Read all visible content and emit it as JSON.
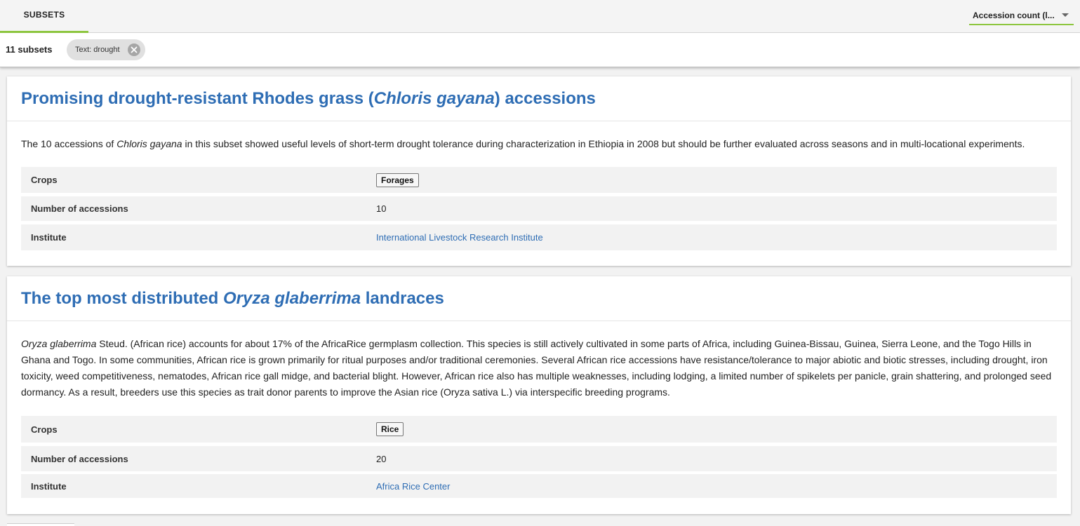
{
  "tabs": {
    "subsets_label": "SUBSETS"
  },
  "sort": {
    "selected": "Accession count (l..."
  },
  "filters": {
    "count_label": "11 subsets",
    "chips": [
      {
        "label": "Text: drought"
      }
    ]
  },
  "subsets": [
    {
      "title_prefix": "Promising drought-resistant Rhodes grass (",
      "title_italic": "Chloris gayana",
      "title_suffix": ") accessions",
      "desc_prefix": "The 10 accessions of ",
      "desc_italic": "Chloris gayana",
      "desc_rest": " in this subset showed useful levels of short-term drought tolerance during characterization in Ethiopia in 2008 but should be further evaluated across seasons and in multi-locational experiments.",
      "crops_label": "Crops",
      "crop": "Forages",
      "accessions_label": "Number of accessions",
      "accessions": "10",
      "institute_label": "Institute",
      "institute": "International Livestock Research Institute"
    },
    {
      "title_prefix": "The top most distributed ",
      "title_italic": "Oryza glaberrima",
      "title_suffix": " landraces",
      "desc_prefix": "",
      "desc_italic": "Oryza glaberrima",
      "desc_rest": " Steud. (African rice) accounts for about 17% of the AfricaRice germplasm collection. This species is still actively cultivated in some parts of Africa, including Guinea-Bissau, Guinea, Sierra Leone, and the Togo Hills in Ghana and Togo. In some communities, African rice is grown primarily for ritual purposes and/or traditional ceremonies. Several African rice accessions have resistance/tolerance to major abiotic and biotic stresses, including drought, iron toxicity, weed competitiveness, nematodes, African rice gall midge, and bacterial blight. However, African rice also has multiple weaknesses, including lodging, a limited number of spikelets per panicle, grain shattering, and prolonged seed dormancy. As a result, breeders use this species as trait donor parents to improve the Asian rice (Oryza sativa L.) via interspecific breeding programs.",
      "crops_label": "Crops",
      "crop": "Rice",
      "accessions_label": "Number of accessions",
      "accessions": "20",
      "institute_label": "Institute",
      "institute": "Africa Rice Center"
    }
  ],
  "colors": {
    "accent": "#8dc63f",
    "link": "#2e6db4"
  },
  "icons": {
    "chip_close": "close-circle-icon",
    "sort_caret": "caret-down-icon"
  }
}
